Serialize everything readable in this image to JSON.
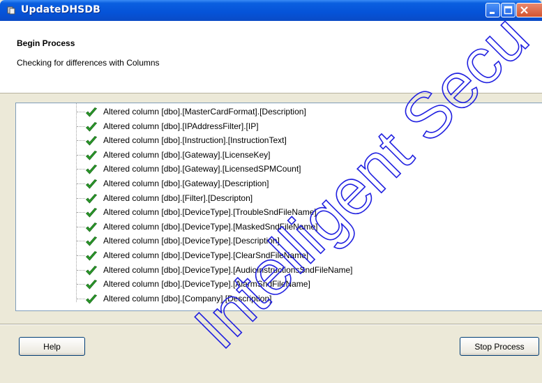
{
  "window": {
    "title": "UpdateDHSDB"
  },
  "header": {
    "title": "Begin Process",
    "subtitle": "Checking for differences with Columns"
  },
  "log": {
    "items": [
      "Altered column [dbo].[MasterCardFormat].[Description]",
      "Altered column [dbo].[IPAddressFilter].[IP]",
      "Altered column [dbo].[Instruction].[InstructionText]",
      "Altered column [dbo].[Gateway].[LicenseKey]",
      "Altered column [dbo].[Gateway].[LicensedSPMCount]",
      "Altered column [dbo].[Gateway].[Description]",
      "Altered column [dbo].[Filter].[Descripton]",
      "Altered column [dbo].[DeviceType].[TroubleSndFileName]",
      "Altered column [dbo].[DeviceType].[MaskedSndFileName]",
      "Altered column [dbo].[DeviceType].[Description]",
      "Altered column [dbo].[DeviceType].[ClearSndFileName]",
      "Altered column [dbo].[DeviceType].[AudioInstructionsSndFileName]",
      "Altered column [dbo].[DeviceType].[AlarmSndFileName]",
      "Altered column [dbo].[Company].[Description]"
    ],
    "item_icon": "green-check-icon"
  },
  "footer": {
    "help_label": "Help",
    "stop_label": "Stop Process"
  },
  "watermark": {
    "text": "Intelligent Secu"
  },
  "colors": {
    "titlebar": "#0553d8",
    "check": "#2a9a2a",
    "watermark": "#2020e0",
    "dialog_bg": "#ece9d8"
  }
}
